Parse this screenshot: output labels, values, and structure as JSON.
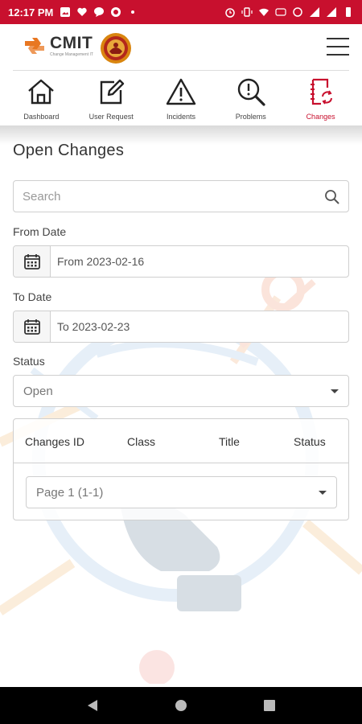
{
  "status_bar": {
    "time": "12:17 PM"
  },
  "header": {
    "logo_name": "CMIT",
    "logo_sub": "Change Management IT"
  },
  "nav": {
    "items": [
      {
        "label": "Dashboard",
        "icon": "home-icon"
      },
      {
        "label": "User Request",
        "icon": "edit-icon"
      },
      {
        "label": "Incidents",
        "icon": "warning-icon"
      },
      {
        "label": "Problems",
        "icon": "search-problem-icon"
      },
      {
        "label": "Changes",
        "icon": "changes-icon",
        "active": true
      }
    ]
  },
  "page": {
    "title": "Open Changes",
    "search_placeholder": "Search",
    "from_label": "From Date",
    "from_value": "From 2023-02-16",
    "to_label": "To Date",
    "to_value": "To 2023-02-23",
    "status_label": "Status",
    "status_value": "Open"
  },
  "table": {
    "columns": [
      "Changes ID",
      "Class",
      "Title",
      "Status"
    ],
    "pager": "Page 1 (1-1)"
  },
  "colors": {
    "brand_red": "#c8102e",
    "accent_orange": "#e87722"
  }
}
